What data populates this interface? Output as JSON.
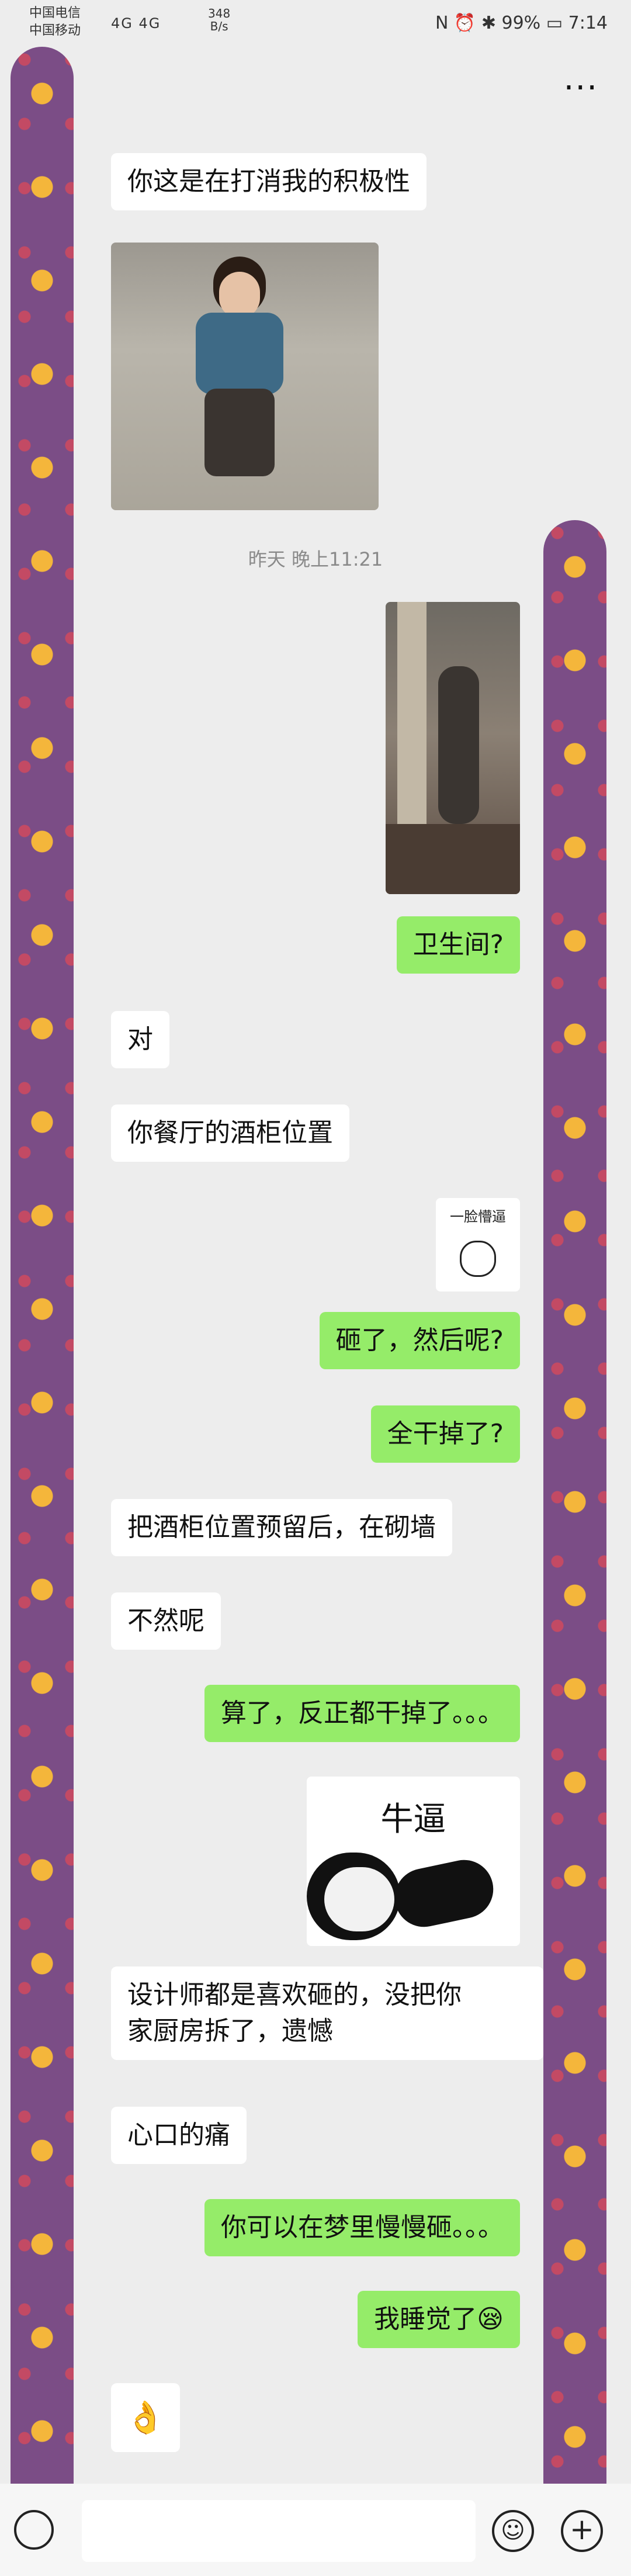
{
  "status_bar": {
    "carrier1": "中国电信",
    "carrier2": "中国移动",
    "signal": "4G 4G",
    "speed_value": "348",
    "speed_unit": "B/s",
    "battery": "99%",
    "time": "7:14"
  },
  "nav": {
    "back_icon": "chevron-left-icon",
    "more_icon": "more-dots-icon"
  },
  "timestamp": "昨天 晚上11:21",
  "messages": [
    {
      "side": "in",
      "text": "你这是在打消我的积极性"
    },
    {
      "side": "out",
      "text": "卫生间?"
    },
    {
      "side": "in",
      "text": "对"
    },
    {
      "side": "in",
      "text": "你餐厅的酒柜位置"
    },
    {
      "side": "out",
      "text": "砸了，然后呢?"
    },
    {
      "side": "out",
      "text": "全干掉了?"
    },
    {
      "side": "in",
      "text": "把酒柜位置预留后，在砌墙"
    },
    {
      "side": "in",
      "text": "不然呢"
    },
    {
      "side": "out",
      "text": "算了，反正都干掉了。。。"
    },
    {
      "side": "in",
      "text": "设计师都是喜欢砸的，没把你"
    },
    {
      "side": "in",
      "text": "家厨房拆了，遗憾"
    },
    {
      "side": "in",
      "text": "心口的痛"
    },
    {
      "side": "out",
      "text": "你可以在梦里慢慢砸。。。"
    },
    {
      "side": "out",
      "text": "我睡觉了😪"
    }
  ],
  "stickers": {
    "face_caption": "一脸懵逼",
    "panda_caption": "牛逼",
    "ok_emoji": "👌"
  },
  "input_bar": {
    "placeholder": ""
  },
  "colors": {
    "background": "#ededed",
    "outgoing": "#95ec69",
    "incoming": "#ffffff"
  }
}
